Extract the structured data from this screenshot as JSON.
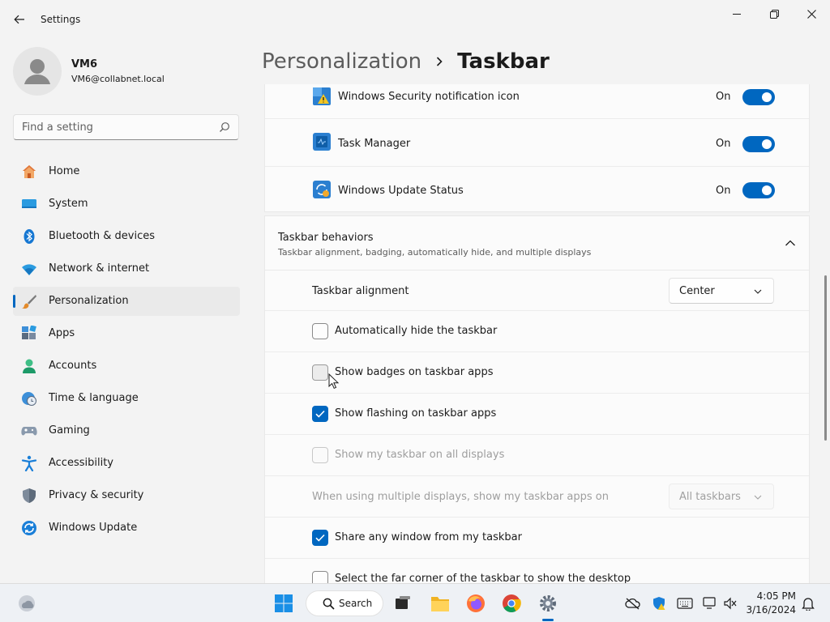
{
  "window": {
    "title": "Settings"
  },
  "user": {
    "name": "VM6",
    "email": "VM6@collabnet.local"
  },
  "search": {
    "placeholder": "Find a setting"
  },
  "sidebar": {
    "items": [
      {
        "label": "Home",
        "icon": "home-icon"
      },
      {
        "label": "System",
        "icon": "system-icon"
      },
      {
        "label": "Bluetooth & devices",
        "icon": "bluetooth-icon"
      },
      {
        "label": "Network & internet",
        "icon": "wifi-icon"
      },
      {
        "label": "Personalization",
        "icon": "brush-icon",
        "active": true
      },
      {
        "label": "Apps",
        "icon": "apps-icon"
      },
      {
        "label": "Accounts",
        "icon": "accounts-icon"
      },
      {
        "label": "Time & language",
        "icon": "globe-clock-icon"
      },
      {
        "label": "Gaming",
        "icon": "gamepad-icon"
      },
      {
        "label": "Accessibility",
        "icon": "accessibility-icon"
      },
      {
        "label": "Privacy & security",
        "icon": "shield-icon"
      },
      {
        "label": "Windows Update",
        "icon": "update-icon"
      }
    ]
  },
  "breadcrumb": {
    "parent": "Personalization",
    "current": "Taskbar"
  },
  "tray_icons": [
    {
      "label": "Windows Security notification icon",
      "state": "On",
      "icon": "security-notification-icon"
    },
    {
      "label": "Task Manager",
      "state": "On",
      "icon": "task-manager-icon"
    },
    {
      "label": "Windows Update Status",
      "state": "On",
      "icon": "windows-update-status-icon"
    }
  ],
  "behaviors": {
    "title": "Taskbar behaviors",
    "subtitle": "Taskbar alignment, badging, automatically hide, and multiple displays",
    "alignment_label": "Taskbar alignment",
    "alignment_value": "Center",
    "options": [
      {
        "label": "Automatically hide the taskbar",
        "checked": false,
        "disabled": false
      },
      {
        "label": "Show badges on taskbar apps",
        "checked": false,
        "disabled": false
      },
      {
        "label": "Show flashing on taskbar apps",
        "checked": true,
        "disabled": false
      },
      {
        "label": "Show my taskbar on all displays",
        "checked": false,
        "disabled": true
      }
    ],
    "multi_display_label": "When using multiple displays, show my taskbar apps on",
    "multi_display_value": "All taskbars",
    "share_label": "Share any window from my taskbar",
    "corner_label": "Select the far corner of the taskbar to show the desktop"
  },
  "taskbar": {
    "search_label": "Search",
    "time": "4:05 PM",
    "date": "3/16/2024"
  },
  "colors": {
    "accent": "#0067c0",
    "background": "#f3f3f3",
    "card": "#fbfbfb"
  }
}
